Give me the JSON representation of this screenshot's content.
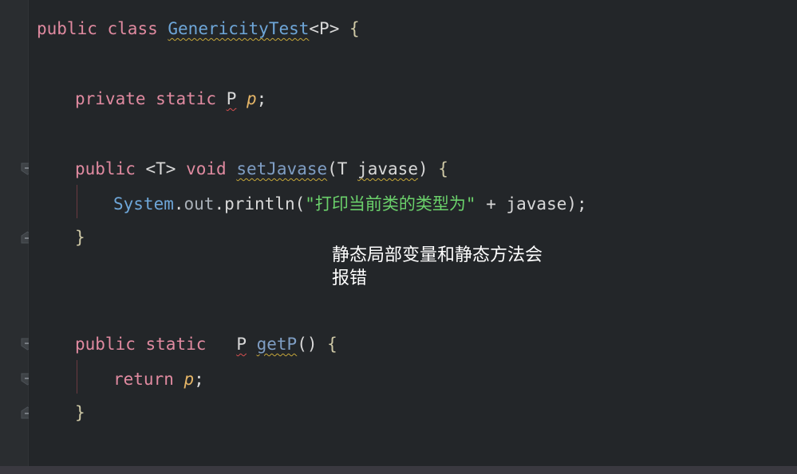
{
  "code": {
    "line1": {
      "kw1": "public",
      "kw2": "class",
      "name": "GenericityTest",
      "params": "<P>",
      "brace": "{"
    },
    "line2": {
      "kw1": "private",
      "kw2": "static",
      "type": "P",
      "field": "p",
      "semi": ";"
    },
    "line3": {
      "kw1": "public",
      "generic": "<T>",
      "kw2": "void",
      "method": "setJavase",
      "open": "(",
      "ptype": "T",
      "pname": "javase",
      "close": ")",
      "brace": "{"
    },
    "line4": {
      "sys": "System",
      "dot1": ".",
      "out": "out",
      "dot2": ".",
      "call": "println",
      "open": "(",
      "str": "\"打印当前类的类型为\"",
      "rest": " + javase);"
    },
    "line5": {
      "brace": "}"
    },
    "line6": {
      "kw1": "public",
      "kw2": "static",
      "type": "P",
      "method": "getP",
      "parens": "()",
      "brace": "{"
    },
    "line7": {
      "kw": "return",
      "field": "p",
      "semi": ";"
    },
    "line8": {
      "brace": "}"
    }
  },
  "annotation": {
    "line1": "静态局部变量和静态方法会",
    "line2": "报错"
  },
  "colors": {
    "background": "#232629",
    "keyword": "#e08aa0",
    "class": "#6ea6d8",
    "field": "#e5b567",
    "string": "#6bd16b"
  }
}
